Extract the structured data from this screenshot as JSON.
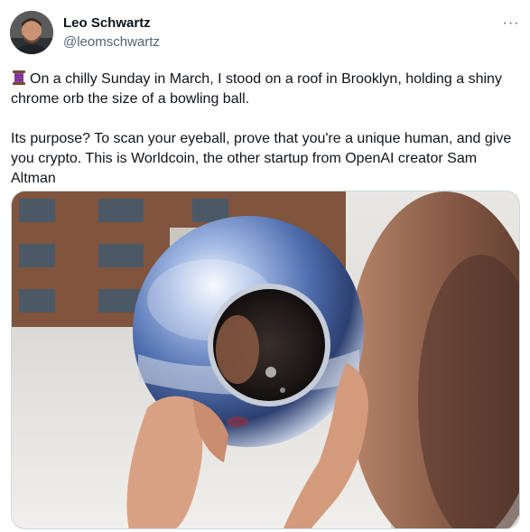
{
  "tweet": {
    "author": {
      "display_name": "Leo Schwartz",
      "handle": "@leomschwartz",
      "avatar_icon": "avatar"
    },
    "more_label": "···",
    "text": {
      "emoji_icon": "spool-of-thread-icon",
      "paragraph_1": "On a chilly Sunday in March, I stood on a roof in Brooklyn, holding a shiny chrome orb the size of a bowling ball.",
      "paragraph_2": "Its purpose? To scan your eyeball, prove that you're a unique human, and give you crypto. This is Worldcoin, the other startup from OpenAI creator Sam Altman"
    },
    "media": {
      "type": "photo",
      "icon": "photo-of-chrome-orb"
    }
  }
}
